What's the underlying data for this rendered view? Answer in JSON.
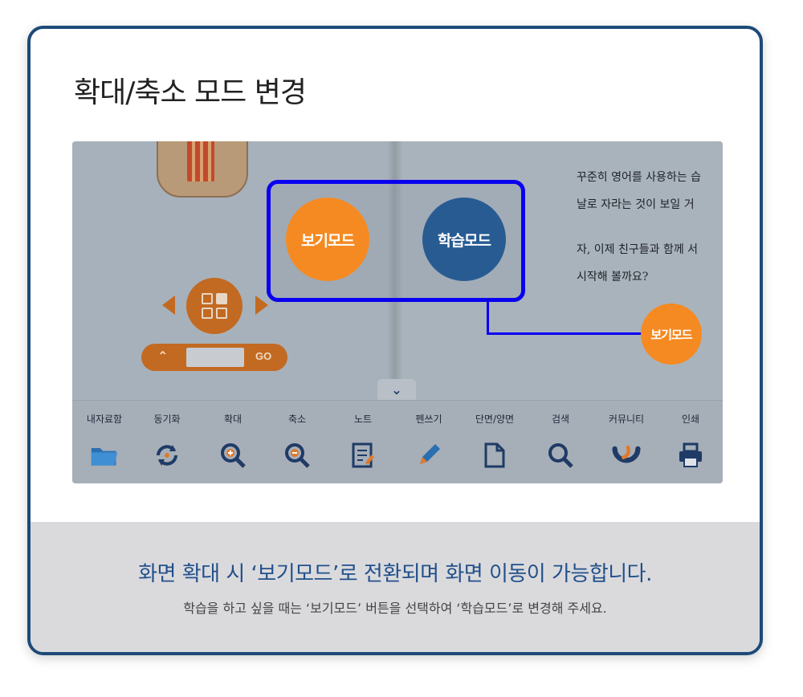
{
  "title": "확대/축소 모드 변경",
  "colors": {
    "border": "#1d4a78",
    "view_mode": "#f58a22",
    "study_mode": "#275b92",
    "highlight": "#0a00f0",
    "message": "#22508a"
  },
  "screenshot": {
    "buttons": {
      "view_mode": "보기모드",
      "study_mode": "학습모드",
      "view_mode_small": "보기모드"
    },
    "pager": {
      "go_label": "GO"
    },
    "book_text": [
      "꾸준히 영어를 사용하는 습",
      "날로 자라는 것이 보일 거",
      "자, 이제 친구들과 함께 서",
      "시작해 볼까요?"
    ],
    "toolbar": [
      {
        "label": "내자료함",
        "icon": "folder-icon"
      },
      {
        "label": "동기화",
        "icon": "sync-icon"
      },
      {
        "label": "확대",
        "icon": "zoom-in-icon"
      },
      {
        "label": "축소",
        "icon": "zoom-out-icon"
      },
      {
        "label": "노트",
        "icon": "note-icon"
      },
      {
        "label": "펜쓰기",
        "icon": "pencil-icon"
      },
      {
        "label": "단면/양면",
        "icon": "page-icon"
      },
      {
        "label": "검색",
        "icon": "search-icon"
      },
      {
        "label": "커뮤니티",
        "icon": "community-icon"
      },
      {
        "label": "인쇄",
        "icon": "print-icon"
      }
    ]
  },
  "message": {
    "main": "화면 확대 시 ‘보기모드’로 전환되며 화면 이동이 가능합니다.",
    "sub": "학습을 하고 싶을 때는 ‘보기모드’ 버튼을 선택하여 ‘학습모드’로 변경해 주세요."
  }
}
